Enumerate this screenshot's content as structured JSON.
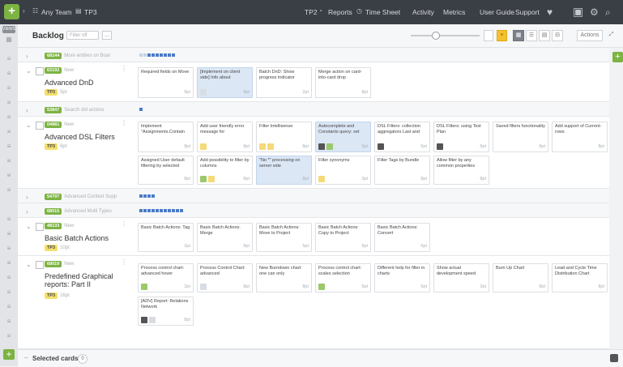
{
  "topbar": {
    "add_label": "+",
    "team": "Any Team",
    "project": "TP3",
    "tp2": "TP2",
    "reports": "Reports",
    "time_sheet": "Time Sheet",
    "activity": "Activity",
    "metrics": "Metrics",
    "user_guide": "User Guide",
    "support": "Support"
  },
  "leftrail": {
    "views_label": "VIEWS",
    "add_label": "+"
  },
  "subheader": {
    "title": "Backlog",
    "filter_placeholder": "Filter off",
    "more_label": "...",
    "actions_label": "Actions",
    "close_label": "×",
    "expand_label": "⤢"
  },
  "lanes": [
    {
      "id": "68144",
      "title": "More entities on Boar",
      "collapsed": true
    },
    {
      "id": "63192",
      "sub": "New",
      "name": "Advanced DnD",
      "project": "TP3",
      "estimate": "5pt",
      "cards": [
        {
          "text": "Required fields on Move",
          "est": "8pt",
          "blue": false
        },
        {
          "text": "[Implement on client side] Info about",
          "est": "8pt",
          "blue": true
        },
        {
          "text": "Batch DnD: Show progress indicator",
          "est": "2pt",
          "blue": false
        },
        {
          "text": "Merge action on card-into-card drop",
          "est": "8pt",
          "blue": false
        }
      ]
    },
    {
      "id": "53847",
      "title": "Search old actions",
      "collapsed": true
    },
    {
      "id": "04881",
      "sub": "New",
      "name": "Advanced DSL Filters",
      "project": "TP3",
      "estimate": "6pt",
      "cards_row1": [
        {
          "text": "Implement \"Assignments.Contain",
          "est": "8pt",
          "blue": false
        },
        {
          "text": "Add user friendly error message for",
          "est": "8pt",
          "blue": false
        },
        {
          "text": "Filter Intellisense",
          "est": "8pt",
          "blue": false
        },
        {
          "text": "Autocomplete and Constants query: set",
          "est": "3pt",
          "blue": true
        },
        {
          "text": "DSL Filters: collection aggregators Last and",
          "est": "5pt",
          "blue": false
        },
        {
          "text": "DSL Filters: using Test Plan",
          "est": "5pt",
          "blue": false
        },
        {
          "text": "Saved filters functionality",
          "est": "8pt",
          "blue": false
        },
        {
          "text": "Add support of Current-rows",
          "est": "8pt",
          "blue": false
        }
      ],
      "cards_row2": [
        {
          "text": "Assigned User default filtering by selected",
          "est": "8pt",
          "blue": false
        },
        {
          "text": "Add possibility to filter by columns",
          "est": "8pt",
          "blue": false
        },
        {
          "text": "\"No *\" processing on server side",
          "est": "8pt",
          "blue": true
        },
        {
          "text": "Filter synonyms",
          "est": "3pt",
          "blue": false
        },
        {
          "text": "Filter Tags by Bundle",
          "est": "8pt",
          "blue": false
        },
        {
          "text": "Allow filter by any common properties",
          "est": "8pt",
          "blue": false
        }
      ]
    },
    {
      "id": "54797",
      "title": "Advanced Context Supp",
      "collapsed": true
    },
    {
      "id": "68015",
      "title": "Advanced Multi Types",
      "collapsed": true
    },
    {
      "id": "48133",
      "sub": "New",
      "name": "Basic Batch Actions",
      "project": "TP3",
      "estimate": "10pt",
      "cards": [
        {
          "text": "Basic Batch Actions: Tag",
          "est": "2pt",
          "blue": false
        },
        {
          "text": "Basic Batch Actions: Merge",
          "est": "8pt",
          "blue": false
        },
        {
          "text": "Basic Batch Actions: Move to Project",
          "est": "5pt",
          "blue": false
        },
        {
          "text": "Basic Batch Actions: Copy to Project",
          "est": "5pt",
          "blue": false
        },
        {
          "text": "Basic Batch Actions: Convert",
          "est": "5pt",
          "blue": false
        }
      ]
    },
    {
      "id": "68019",
      "sub": "New",
      "name": "Predefined Graphical reports: Part II",
      "project": "TP3",
      "estimate": "16pt",
      "cards_row1": [
        {
          "text": "Process control chart: advanced hover",
          "est": "2pt",
          "blue": false
        },
        {
          "text": "Process Control Chart: advanced",
          "est": "8pt",
          "blue": false
        },
        {
          "text": "New Burndown chart: one can only",
          "est": "8pt",
          "blue": false
        },
        {
          "text": "Process control chart: scales selection",
          "est": "5pt",
          "blue": false
        },
        {
          "text": "Different help for filter in charts",
          "est": "5pt",
          "blue": false
        },
        {
          "text": "Show actual development speed",
          "est": "2pt",
          "blue": false
        },
        {
          "text": "Burn Up Chart",
          "est": "8pt",
          "blue": false
        },
        {
          "text": "Lead and Cycle Time Distribution Chart",
          "est": "8pt",
          "blue": false
        }
      ],
      "cards_row2": [
        {
          "text": "[ADV] Report: Relations Network",
          "est": "8pt",
          "blue": false
        }
      ]
    }
  ],
  "footer": {
    "label": "Selected cards",
    "count": "0"
  },
  "colors": {
    "topbar": "#3a3e45",
    "green": "#7cb342",
    "card_blue": "#dbe7f5",
    "yellow_tag": "#f3df6b"
  }
}
